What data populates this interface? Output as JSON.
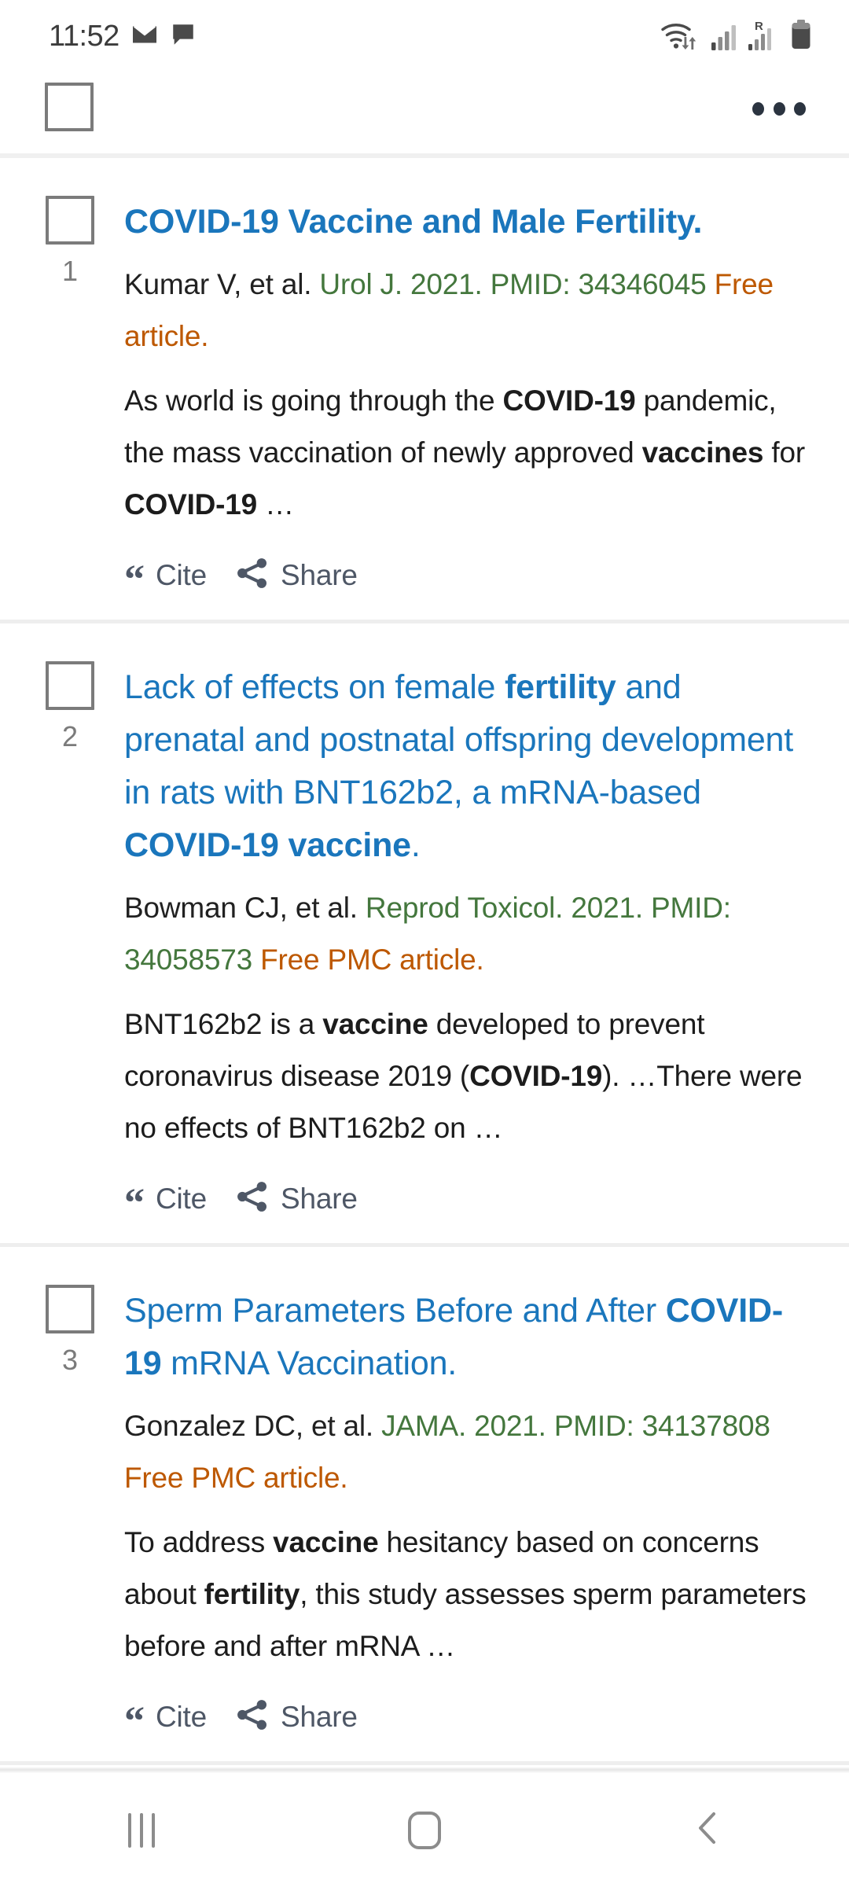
{
  "status_bar": {
    "clock": "11:52",
    "left_icons": [
      "envelope-icon",
      "chat-bubble-icon"
    ],
    "right_icons": [
      "wifi-data-icon",
      "signal-bars-icon",
      "roaming-signal-icon",
      "battery-icon"
    ],
    "roaming_label": "R"
  },
  "header": {
    "select_all_checkbox": "unchecked",
    "overflow_menu": "more-options"
  },
  "results": [
    {
      "index": "1",
      "title_bold": true,
      "title_parts": [
        {
          "text": "COVID-19 Vaccine",
          "bold": true
        },
        {
          "text": " and Male ",
          "bold": false
        },
        {
          "text": "Fertility",
          "bold": true
        },
        {
          "text": ".",
          "bold": false
        }
      ],
      "authors": "Kumar V, et al.",
      "journal": "Urol J. 2021. PMID: 34346045",
      "free_tag": "Free article.",
      "snippet_parts": [
        {
          "text": "As world is going through the ",
          "bold": false
        },
        {
          "text": "COVID-19",
          "bold": true
        },
        {
          "text": " pandemic, the mass vaccination of newly approved ",
          "bold": false
        },
        {
          "text": "vaccines",
          "bold": true
        },
        {
          "text": " for ",
          "bold": false
        },
        {
          "text": "COVID-19",
          "bold": true
        },
        {
          "text": " …",
          "bold": false
        }
      ],
      "cite_label": "Cite",
      "share_label": "Share"
    },
    {
      "index": "2",
      "title_bold": false,
      "title_parts": [
        {
          "text": "Lack of effects on female ",
          "bold": false
        },
        {
          "text": "fertility",
          "bold": true
        },
        {
          "text": " and prenatal and postnatal offspring development in rats with BNT162b2, a mRNA-based ",
          "bold": false
        },
        {
          "text": "COVID-19 vaccine",
          "bold": true
        },
        {
          "text": ".",
          "bold": false
        }
      ],
      "authors": "Bowman CJ, et al.",
      "journal": "Reprod Toxicol. 2021. PMID: 34058573",
      "free_tag": "Free PMC article.",
      "snippet_parts": [
        {
          "text": "BNT162b2 is a ",
          "bold": false
        },
        {
          "text": "vaccine",
          "bold": true
        },
        {
          "text": " developed to prevent coronavirus disease 2019 (",
          "bold": false
        },
        {
          "text": "COVID-19",
          "bold": true
        },
        {
          "text": "). …There were no effects of BNT162b2 on …",
          "bold": false
        }
      ],
      "cite_label": "Cite",
      "share_label": "Share"
    },
    {
      "index": "3",
      "title_bold": false,
      "title_parts": [
        {
          "text": "Sperm Parameters Before and After ",
          "bold": false
        },
        {
          "text": "COVID-19",
          "bold": true
        },
        {
          "text": " mRNA Vaccination.",
          "bold": false
        }
      ],
      "authors": "Gonzalez DC, et al.",
      "journal": "JAMA. 2021. PMID: 34137808",
      "free_tag": "Free PMC article.",
      "snippet_parts": [
        {
          "text": "To address ",
          "bold": false
        },
        {
          "text": "vaccine",
          "bold": true
        },
        {
          "text": " hesitancy based on concerns about ",
          "bold": false
        },
        {
          "text": "fertility",
          "bold": true
        },
        {
          "text": ", this study assesses sperm parameters before and after mRNA …",
          "bold": false
        }
      ],
      "cite_label": "Cite",
      "share_label": "Share"
    }
  ],
  "nav_bar": {
    "recents": "recents-icon",
    "home": "home-icon",
    "back": "back-icon"
  },
  "colors": {
    "link_blue": "#1a76bc",
    "journal_green": "#44773d",
    "free_orange": "#bd5800",
    "action_gray": "#4e5766",
    "checkbox_border": "#7b7b7b",
    "divider": "#eeeeee"
  }
}
